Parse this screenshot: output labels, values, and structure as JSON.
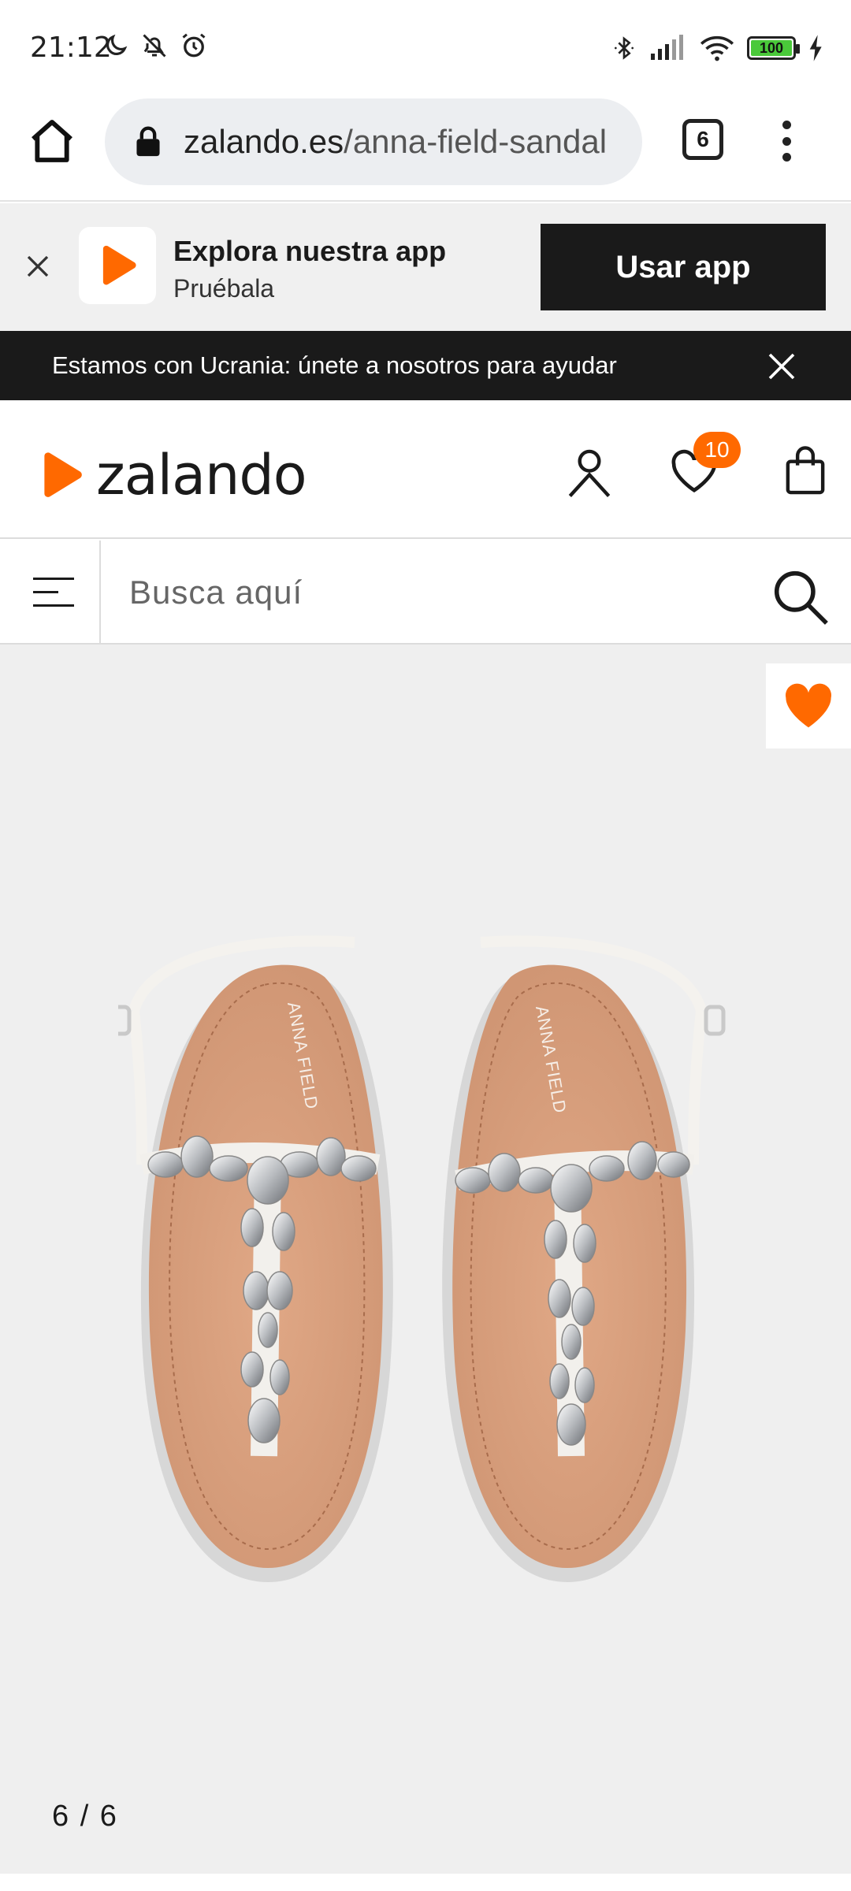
{
  "status_bar": {
    "time": "21:12",
    "battery_level": "100",
    "left_icons": [
      "moon-icon",
      "bell-off-icon",
      "alarm-icon"
    ],
    "right_icons": [
      "bluetooth-icon",
      "signal-icon",
      "wifi-icon",
      "battery-icon",
      "charging-icon"
    ]
  },
  "browser": {
    "url_domain": "zalando.es",
    "url_path": "/anna-field-sandal",
    "tab_count": "6"
  },
  "app_banner": {
    "title": "Explora nuestra app",
    "subtitle": "Pruébala",
    "button_label": "Usar app"
  },
  "notice": {
    "text": "Estamos con Ucrania: únete a nosotros para ayudar"
  },
  "header": {
    "logo_text": "zalando",
    "wishlist_count": "10"
  },
  "search": {
    "placeholder": "Busca aquí"
  },
  "product": {
    "image_counter": "6 / 6",
    "brand_print": "ANNA FIELD"
  },
  "colors": {
    "brand_orange": "#ff6900",
    "dark": "#1a1a1a",
    "banner_bg": "#f0f0f0",
    "image_bg": "#efefef"
  }
}
